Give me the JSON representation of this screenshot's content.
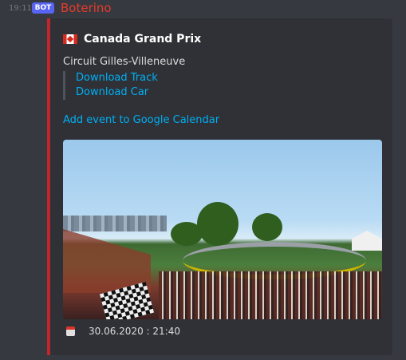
{
  "message": {
    "timestamp": "19:11",
    "badge": "BOT",
    "username": "Boterino"
  },
  "embed": {
    "accent_color": "#c0262b",
    "flag_icon": "canada-flag-icon",
    "title": "Canada Grand Prix",
    "circuit": "Circuit Gilles-Villeneuve",
    "links": [
      {
        "label": "Download Track"
      },
      {
        "label": "Download Car"
      }
    ],
    "calendar_link": "Add event to Google Calendar",
    "footer_icon": "calendar-icon",
    "footer_text": "30.06.2020 : 21:40"
  }
}
